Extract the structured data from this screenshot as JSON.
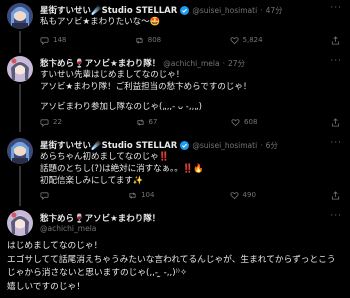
{
  "tweets": [
    {
      "name": "星街すいせい☄️Studio STELLAR",
      "handle": "@suisei_hosimati",
      "time": "47分",
      "text_lines": [
        "私もアソビ★まわりたいな〜🤩"
      ],
      "stats": {
        "replies": "148",
        "retweets": "808",
        "likes": "5,824"
      }
    },
    {
      "name": "愁卞めら🍷アソビ★まわり隊！",
      "handle": "@achichi_mela",
      "time": "27分",
      "text_lines": [
        "すいせい先輩はじめましてなのじゃ！",
        "アソビ★まわり隊！ご利益担当の愁卞めらですのじゃ！",
        "",
        "アソビまわり参加し隊なのじゃ(„,,- ᴗ -,,„)"
      ],
      "stats": {
        "replies": "22",
        "retweets": "67",
        "likes": "608"
      }
    },
    {
      "name": "星街すいせい☄️Studio STELLAR",
      "handle": "@suisei_hosimati",
      "time": "6分",
      "text_lines": [
        "めらちゃん初めましてなのじゃ‼️",
        "話題のとちし(?)は絶対に消すなぁ。。‼️🔥",
        "初配信楽しみにしてます✨"
      ],
      "stats": {
        "replies": "",
        "retweets": "104",
        "likes": "490"
      }
    },
    {
      "name": "愁卞めら🍷アソビ★まわり隊！",
      "handle": "@achichi_mela",
      "text_lines": [
        "はじめましてなのじゃ！",
        "エゴサしてて話尾消えちゃうみたいな言われてるんじゃが、生まれてからずっとこう",
        "じゃから消さないと思いますのじゃ(,,- ̫ -,,)⁾⁾✧",
        "嬉しいですのじゃ！"
      ]
    }
  ]
}
